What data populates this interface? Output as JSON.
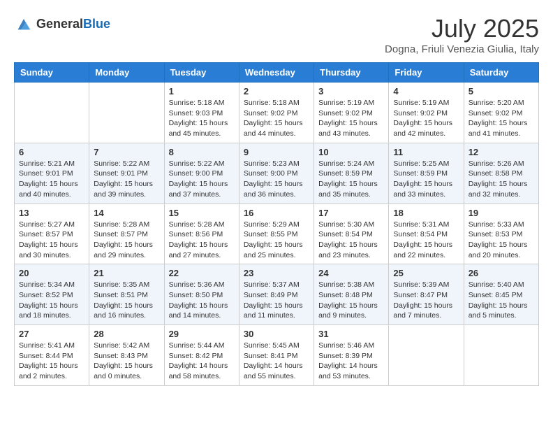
{
  "logo": {
    "general": "General",
    "blue": "Blue"
  },
  "title": "July 2025",
  "subtitle": "Dogna, Friuli Venezia Giulia, Italy",
  "days_of_week": [
    "Sunday",
    "Monday",
    "Tuesday",
    "Wednesday",
    "Thursday",
    "Friday",
    "Saturday"
  ],
  "weeks": [
    [
      {
        "day": "",
        "sunrise": "",
        "sunset": "",
        "daylight": ""
      },
      {
        "day": "",
        "sunrise": "",
        "sunset": "",
        "daylight": ""
      },
      {
        "day": "1",
        "sunrise": "Sunrise: 5:18 AM",
        "sunset": "Sunset: 9:03 PM",
        "daylight": "Daylight: 15 hours and 45 minutes."
      },
      {
        "day": "2",
        "sunrise": "Sunrise: 5:18 AM",
        "sunset": "Sunset: 9:02 PM",
        "daylight": "Daylight: 15 hours and 44 minutes."
      },
      {
        "day": "3",
        "sunrise": "Sunrise: 5:19 AM",
        "sunset": "Sunset: 9:02 PM",
        "daylight": "Daylight: 15 hours and 43 minutes."
      },
      {
        "day": "4",
        "sunrise": "Sunrise: 5:19 AM",
        "sunset": "Sunset: 9:02 PM",
        "daylight": "Daylight: 15 hours and 42 minutes."
      },
      {
        "day": "5",
        "sunrise": "Sunrise: 5:20 AM",
        "sunset": "Sunset: 9:02 PM",
        "daylight": "Daylight: 15 hours and 41 minutes."
      }
    ],
    [
      {
        "day": "6",
        "sunrise": "Sunrise: 5:21 AM",
        "sunset": "Sunset: 9:01 PM",
        "daylight": "Daylight: 15 hours and 40 minutes."
      },
      {
        "day": "7",
        "sunrise": "Sunrise: 5:22 AM",
        "sunset": "Sunset: 9:01 PM",
        "daylight": "Daylight: 15 hours and 39 minutes."
      },
      {
        "day": "8",
        "sunrise": "Sunrise: 5:22 AM",
        "sunset": "Sunset: 9:00 PM",
        "daylight": "Daylight: 15 hours and 37 minutes."
      },
      {
        "day": "9",
        "sunrise": "Sunrise: 5:23 AM",
        "sunset": "Sunset: 9:00 PM",
        "daylight": "Daylight: 15 hours and 36 minutes."
      },
      {
        "day": "10",
        "sunrise": "Sunrise: 5:24 AM",
        "sunset": "Sunset: 8:59 PM",
        "daylight": "Daylight: 15 hours and 35 minutes."
      },
      {
        "day": "11",
        "sunrise": "Sunrise: 5:25 AM",
        "sunset": "Sunset: 8:59 PM",
        "daylight": "Daylight: 15 hours and 33 minutes."
      },
      {
        "day": "12",
        "sunrise": "Sunrise: 5:26 AM",
        "sunset": "Sunset: 8:58 PM",
        "daylight": "Daylight: 15 hours and 32 minutes."
      }
    ],
    [
      {
        "day": "13",
        "sunrise": "Sunrise: 5:27 AM",
        "sunset": "Sunset: 8:57 PM",
        "daylight": "Daylight: 15 hours and 30 minutes."
      },
      {
        "day": "14",
        "sunrise": "Sunrise: 5:28 AM",
        "sunset": "Sunset: 8:57 PM",
        "daylight": "Daylight: 15 hours and 29 minutes."
      },
      {
        "day": "15",
        "sunrise": "Sunrise: 5:28 AM",
        "sunset": "Sunset: 8:56 PM",
        "daylight": "Daylight: 15 hours and 27 minutes."
      },
      {
        "day": "16",
        "sunrise": "Sunrise: 5:29 AM",
        "sunset": "Sunset: 8:55 PM",
        "daylight": "Daylight: 15 hours and 25 minutes."
      },
      {
        "day": "17",
        "sunrise": "Sunrise: 5:30 AM",
        "sunset": "Sunset: 8:54 PM",
        "daylight": "Daylight: 15 hours and 23 minutes."
      },
      {
        "day": "18",
        "sunrise": "Sunrise: 5:31 AM",
        "sunset": "Sunset: 8:54 PM",
        "daylight": "Daylight: 15 hours and 22 minutes."
      },
      {
        "day": "19",
        "sunrise": "Sunrise: 5:33 AM",
        "sunset": "Sunset: 8:53 PM",
        "daylight": "Daylight: 15 hours and 20 minutes."
      }
    ],
    [
      {
        "day": "20",
        "sunrise": "Sunrise: 5:34 AM",
        "sunset": "Sunset: 8:52 PM",
        "daylight": "Daylight: 15 hours and 18 minutes."
      },
      {
        "day": "21",
        "sunrise": "Sunrise: 5:35 AM",
        "sunset": "Sunset: 8:51 PM",
        "daylight": "Daylight: 15 hours and 16 minutes."
      },
      {
        "day": "22",
        "sunrise": "Sunrise: 5:36 AM",
        "sunset": "Sunset: 8:50 PM",
        "daylight": "Daylight: 15 hours and 14 minutes."
      },
      {
        "day": "23",
        "sunrise": "Sunrise: 5:37 AM",
        "sunset": "Sunset: 8:49 PM",
        "daylight": "Daylight: 15 hours and 11 minutes."
      },
      {
        "day": "24",
        "sunrise": "Sunrise: 5:38 AM",
        "sunset": "Sunset: 8:48 PM",
        "daylight": "Daylight: 15 hours and 9 minutes."
      },
      {
        "day": "25",
        "sunrise": "Sunrise: 5:39 AM",
        "sunset": "Sunset: 8:47 PM",
        "daylight": "Daylight: 15 hours and 7 minutes."
      },
      {
        "day": "26",
        "sunrise": "Sunrise: 5:40 AM",
        "sunset": "Sunset: 8:45 PM",
        "daylight": "Daylight: 15 hours and 5 minutes."
      }
    ],
    [
      {
        "day": "27",
        "sunrise": "Sunrise: 5:41 AM",
        "sunset": "Sunset: 8:44 PM",
        "daylight": "Daylight: 15 hours and 2 minutes."
      },
      {
        "day": "28",
        "sunrise": "Sunrise: 5:42 AM",
        "sunset": "Sunset: 8:43 PM",
        "daylight": "Daylight: 15 hours and 0 minutes."
      },
      {
        "day": "29",
        "sunrise": "Sunrise: 5:44 AM",
        "sunset": "Sunset: 8:42 PM",
        "daylight": "Daylight: 14 hours and 58 minutes."
      },
      {
        "day": "30",
        "sunrise": "Sunrise: 5:45 AM",
        "sunset": "Sunset: 8:41 PM",
        "daylight": "Daylight: 14 hours and 55 minutes."
      },
      {
        "day": "31",
        "sunrise": "Sunrise: 5:46 AM",
        "sunset": "Sunset: 8:39 PM",
        "daylight": "Daylight: 14 hours and 53 minutes."
      },
      {
        "day": "",
        "sunrise": "",
        "sunset": "",
        "daylight": ""
      },
      {
        "day": "",
        "sunrise": "",
        "sunset": "",
        "daylight": ""
      }
    ]
  ]
}
